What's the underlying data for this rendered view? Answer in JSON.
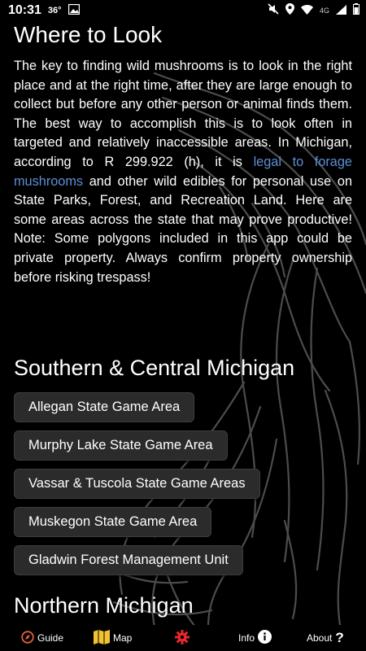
{
  "status_bar": {
    "time": "10:31",
    "temperature": "36°",
    "network": "4G"
  },
  "page": {
    "title": "Where to Look",
    "intro_part1": "The key to finding wild mushrooms is to look in the right place and at the right time, after they are large enough to collect but before any other person or animal finds them. The best way to accomplish this is to look often in targeted and relatively inaccessible areas. In Michigan, according to R 299.922 (h), it is ",
    "intro_link": "legal to forage mushrooms",
    "intro_part2": " and other wild edibles for personal use on State Parks, Forest, and Recreation Land. Here are some areas across the state that may prove productive! Note: Some polygons included in this app could be private property. Always confirm property ownership before risking trespass!"
  },
  "sections": [
    {
      "title": "Southern & Central Michigan",
      "areas": [
        "Allegan State Game Area",
        "Murphy Lake State Game Area",
        "Vassar & Tuscola State Game Areas",
        "Muskegon State Game Area",
        "Gladwin Forest Management Unit"
      ]
    },
    {
      "title": "Northern Michigan",
      "areas": []
    }
  ],
  "bottom_nav": {
    "guide": "Guide",
    "map": "Map",
    "info": "Info",
    "about": "About"
  },
  "colors": {
    "background": "#000000",
    "link": "#5b8fd6",
    "button": "#2b2b2b",
    "settings_icon": "#e8282b",
    "map_icon": "#f2c230",
    "guide_icon": "#e0603a"
  }
}
